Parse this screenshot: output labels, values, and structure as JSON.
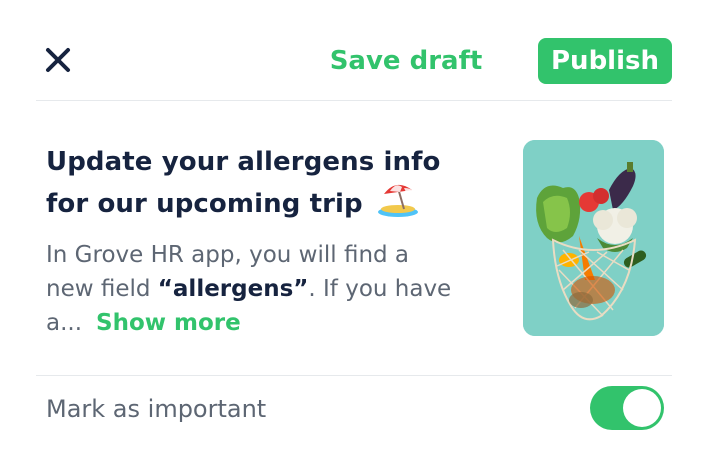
{
  "header": {
    "close_icon": "close-icon",
    "save_draft_label": "Save draft",
    "publish_label": "Publish"
  },
  "post": {
    "title_line1": "Update your allergens info",
    "title_line2": "for our upcoming trip",
    "title_emoji": "beach-umbrella-icon",
    "body_line1": "In Grove HR app, you will find a",
    "body_line2_prefix": "new field ",
    "body_line2_bold": "“allergens”",
    "body_line2_suffix": ". If you have",
    "body_line3": "a...",
    "show_more_label": "Show more",
    "image": "grocery-bag-with-vegetables"
  },
  "settings": {
    "mark_important_label": "Mark as important",
    "mark_important_enabled": true
  },
  "colors": {
    "accent": "#32c36c",
    "title": "#16233f",
    "body": "#5d6673",
    "image_bg": "#7fd0c6"
  }
}
